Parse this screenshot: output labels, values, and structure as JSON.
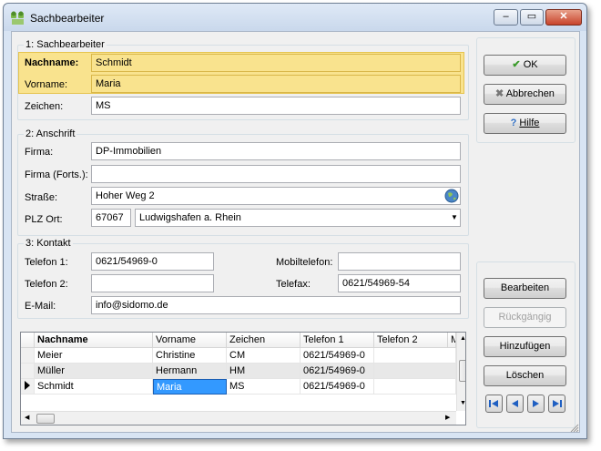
{
  "window": {
    "title": "Sachbearbeiter",
    "minimize": "‒",
    "maximize": "▭",
    "close": "✕"
  },
  "section1": {
    "title": "1: Sachbearbeiter",
    "nachname_label": "Nachname:",
    "nachname": "Schmidt",
    "vorname_label": "Vorname:",
    "vorname": "Maria",
    "zeichen_label": "Zeichen:",
    "zeichen": "MS"
  },
  "section2": {
    "title": "2: Anschrift",
    "firma_label": "Firma:",
    "firma": "DP-Immobilien",
    "firma2_label": "Firma (Forts.):",
    "firma2": "",
    "strasse_label": "Straße:",
    "strasse": "Hoher Weg 2",
    "plzort_label": "PLZ Ort:",
    "plz": "67067",
    "ort": "Ludwigshafen a. Rhein"
  },
  "section3": {
    "title": "3: Kontakt",
    "telefon1_label": "Telefon 1:",
    "telefon1": "0621/54969-0",
    "telefon2_label": "Telefon 2:",
    "telefon2": "",
    "mobil_label": "Mobiltelefon:",
    "mobil": "",
    "telefax_label": "Telefax:",
    "telefax": "0621/54969-54",
    "email_label": "E-Mail:",
    "email": "info@sidomo.de"
  },
  "buttons": {
    "ok": "OK",
    "abbrechen": "Abbrechen",
    "hilfe": "Hilfe",
    "bearbeiten": "Bearbeiten",
    "rueckgaengig": "Rückgängig",
    "hinzufuegen": "Hinzufügen",
    "loeschen": "Löschen"
  },
  "grid": {
    "columns": [
      "Nachname",
      "Vorname",
      "Zeichen",
      "Telefon 1",
      "Telefon 2",
      "M"
    ],
    "rows": [
      [
        "Meier",
        "Christine",
        "CM",
        "0621/54969-0",
        ""
      ],
      [
        "Müller",
        "Hermann",
        "HM",
        "0621/54969-0",
        ""
      ],
      [
        "Schmidt",
        "Maria",
        "MS",
        "0621/54969-0",
        ""
      ]
    ]
  },
  "colors": {
    "highlight": "#f9e38e",
    "selection": "#3399ff",
    "titlebar": "#c9d8ec"
  }
}
